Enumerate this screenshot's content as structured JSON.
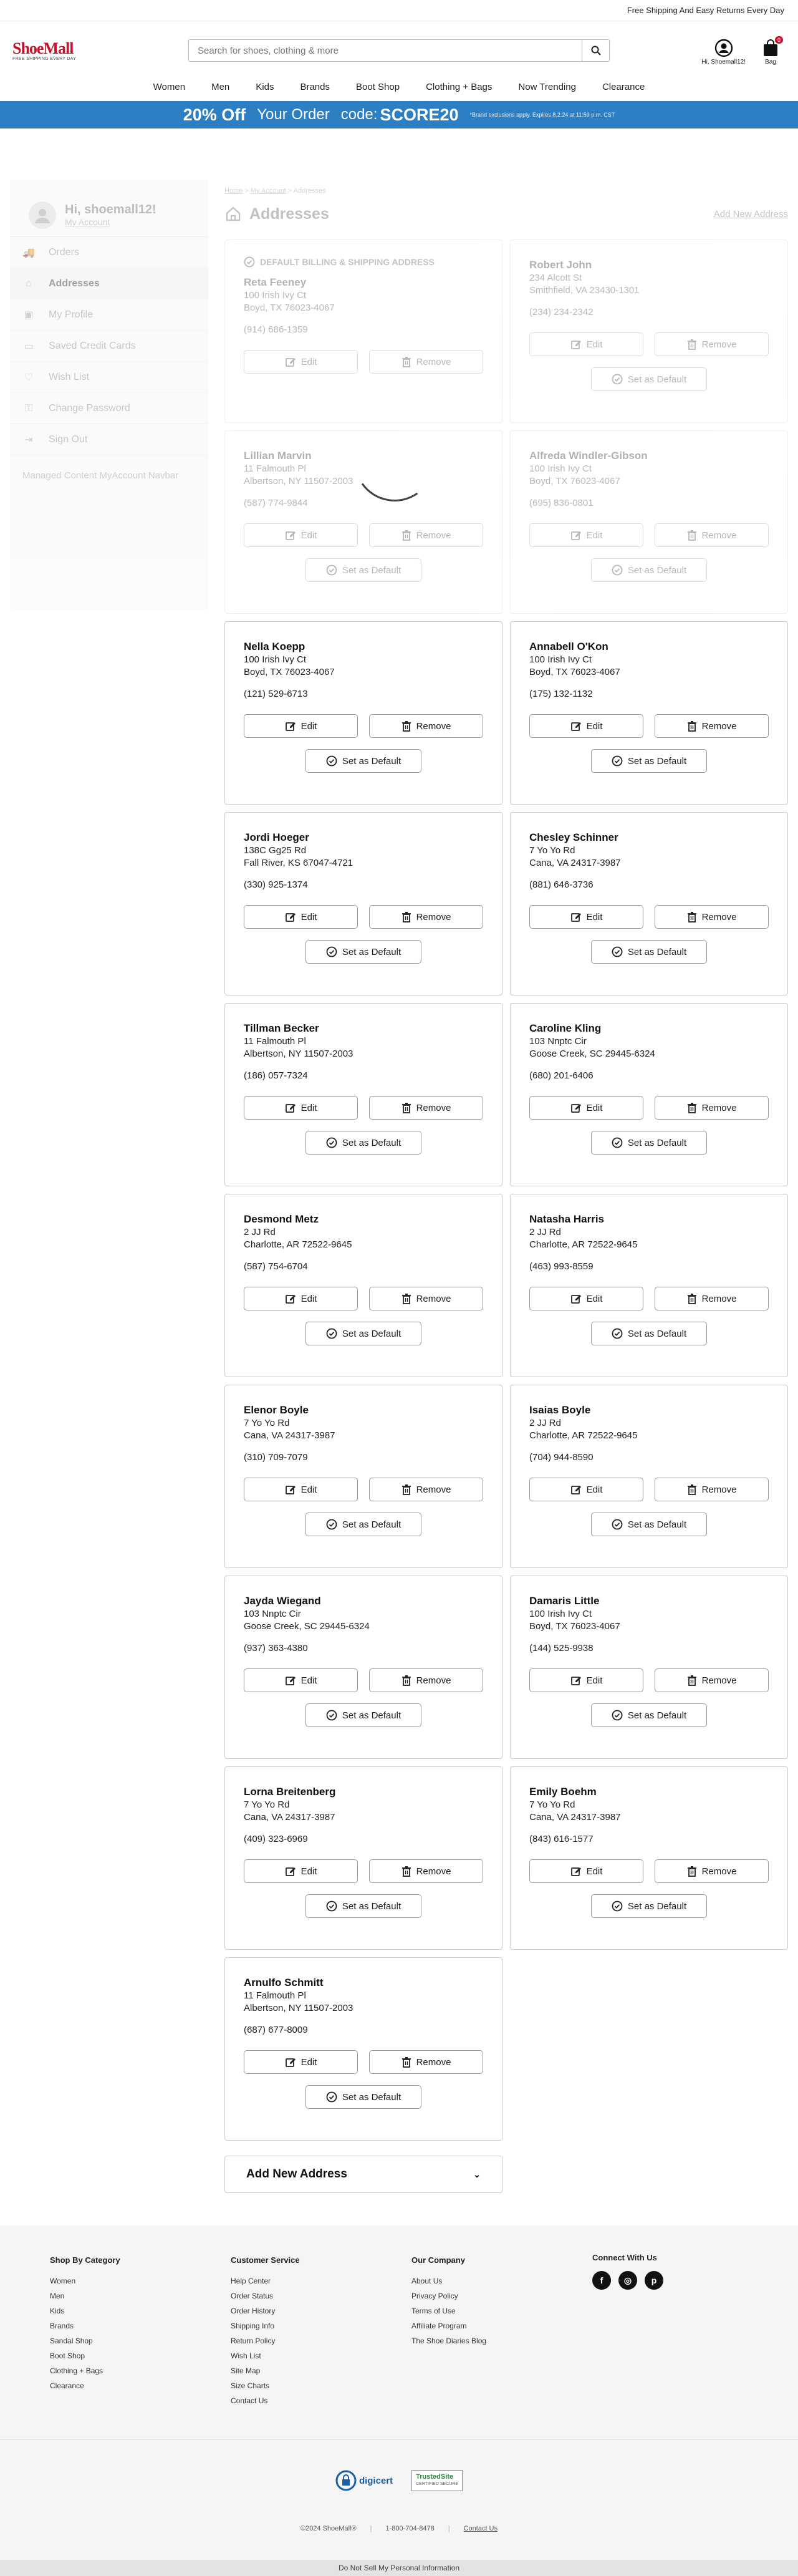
{
  "topbar": {
    "text": "Free Shipping And Easy Returns Every Day"
  },
  "header": {
    "logo": "ShoeMall",
    "logo_tagline": "FREE SHIPPING EVERY DAY",
    "search_placeholder": "Search for shoes, clothing & more",
    "user_label": "Hi, Shoemall12!",
    "bag_label": "Bag",
    "bag_count": "0"
  },
  "nav": [
    "Women",
    "Men",
    "Kids",
    "Brands",
    "Boot Shop",
    "Clothing + Bags",
    "Now Trending",
    "Clearance"
  ],
  "promo": {
    "big": "20% Off",
    "mid": "Your Order",
    "code_label": "code:",
    "code": "SCORE20",
    "fine": "*Brand exclusions apply. Expires 8.2.24 at 11:59 p.m. CST"
  },
  "sidebar": {
    "greeting": "Hi, shoemall12!",
    "my_account": "My Account",
    "items": [
      "Orders",
      "Addresses",
      "My Profile",
      "Saved Credit Cards",
      "Wish List",
      "Change Password",
      "Sign Out"
    ],
    "note": "Managed Content MyAccount Navbar"
  },
  "breadcrumb": [
    "Home",
    "My Account",
    "Addresses"
  ],
  "page": {
    "title": "Addresses",
    "add_link": "Add New Address",
    "default_label": "DEFAULT BILLING & SHIPPING ADDRESS",
    "edit_label": "Edit",
    "remove_label": "Remove",
    "set_default_label": "Set as Default",
    "add_new_label": "Add New Address"
  },
  "addresses": [
    {
      "name": "Reta Feeney",
      "street": "100 Irish Ivy Ct",
      "city": "Boyd, TX 76023-4067",
      "phone": "(914) 686-1359"
    },
    {
      "name": "Robert John",
      "street": "234 Alcott St",
      "city": "Smithfield, VA 23430-1301",
      "phone": "(234) 234-2342"
    },
    {
      "name": "Lillian Marvin",
      "street": "11 Falmouth Pl",
      "city": "Albertson, NY 11507-2003",
      "phone": "(587) 774-9844"
    },
    {
      "name": "Alfreda Windler-Gibson",
      "street": "100 Irish Ivy Ct",
      "city": "Boyd, TX 76023-4067",
      "phone": "(695) 836-0801"
    },
    {
      "name": "Nella Koepp",
      "street": "100 Irish Ivy Ct",
      "city": "Boyd, TX 76023-4067",
      "phone": "(121) 529-6713"
    },
    {
      "name": "Annabell O'Kon",
      "street": "100 Irish Ivy Ct",
      "city": "Boyd, TX 76023-4067",
      "phone": "(175) 132-1132"
    },
    {
      "name": "Jordi Hoeger",
      "street": "138C Gg25 Rd",
      "city": "Fall River, KS 67047-4721",
      "phone": "(330) 925-1374"
    },
    {
      "name": "Chesley Schinner",
      "street": "7 Yo Yo Rd",
      "city": "Cana, VA 24317-3987",
      "phone": "(881) 646-3736"
    },
    {
      "name": "Tillman Becker",
      "street": "11 Falmouth Pl",
      "city": "Albertson, NY 11507-2003",
      "phone": "(186) 057-7324"
    },
    {
      "name": "Caroline Kling",
      "street": "103 Nnptc Cir",
      "city": "Goose Creek, SC 29445-6324",
      "phone": "(680) 201-6406"
    },
    {
      "name": "Desmond Metz",
      "street": "2 JJ Rd",
      "city": "Charlotte, AR 72522-9645",
      "phone": "(587) 754-6704"
    },
    {
      "name": "Natasha Harris",
      "street": "2 JJ Rd",
      "city": "Charlotte, AR 72522-9645",
      "phone": "(463) 993-8559"
    },
    {
      "name": "Elenor Boyle",
      "street": "7 Yo Yo Rd",
      "city": "Cana, VA 24317-3987",
      "phone": "(310) 709-7079"
    },
    {
      "name": "Isaias Boyle",
      "street": "2 JJ Rd",
      "city": "Charlotte, AR 72522-9645",
      "phone": "(704) 944-8590"
    },
    {
      "name": "Jayda Wiegand",
      "street": "103 Nnptc Cir",
      "city": "Goose Creek, SC 29445-6324",
      "phone": "(937) 363-4380"
    },
    {
      "name": "Damaris Little",
      "street": "100 Irish Ivy Ct",
      "city": "Boyd, TX 76023-4067",
      "phone": "(144) 525-9938"
    },
    {
      "name": "Lorna Breitenberg",
      "street": "7 Yo Yo Rd",
      "city": "Cana, VA 24317-3987",
      "phone": "(409) 323-6969"
    },
    {
      "name": "Emily Boehm",
      "street": "7 Yo Yo Rd",
      "city": "Cana, VA 24317-3987",
      "phone": "(843) 616-1577"
    },
    {
      "name": "Arnulfo Schmitt",
      "street": "11 Falmouth Pl",
      "city": "Albertson, NY 11507-2003",
      "phone": "(687) 677-8009"
    }
  ],
  "footer": {
    "col1": {
      "title": "Shop By Category",
      "links": [
        "Women",
        "Men",
        "Kids",
        "Brands",
        "Sandal Shop",
        "Boot Shop",
        "Clothing + Bags",
        "Clearance"
      ]
    },
    "col2": {
      "title": "Customer Service",
      "links": [
        "Help Center",
        "Order Status",
        "Order History",
        "Shipping Info",
        "Return Policy",
        "Wish List",
        "Site Map",
        "Size Charts",
        "Contact Us"
      ]
    },
    "col3": {
      "title": "Our Company",
      "links": [
        "About Us",
        "Privacy Policy",
        "Terms of Use",
        "Affiliate Program",
        "The Shoe Diaries Blog"
      ]
    },
    "col4": {
      "title": "Connect With Us"
    },
    "badge1": "digicert",
    "badge2": "TrustedSite",
    "badge2_sub": "CERTIFIED SECURE",
    "copyright": "©2024 ShoeMall®",
    "phone": "1-800-704-8478",
    "contact": "Contact Us",
    "dnsmpi": "Do Not Sell My Personal Information"
  }
}
